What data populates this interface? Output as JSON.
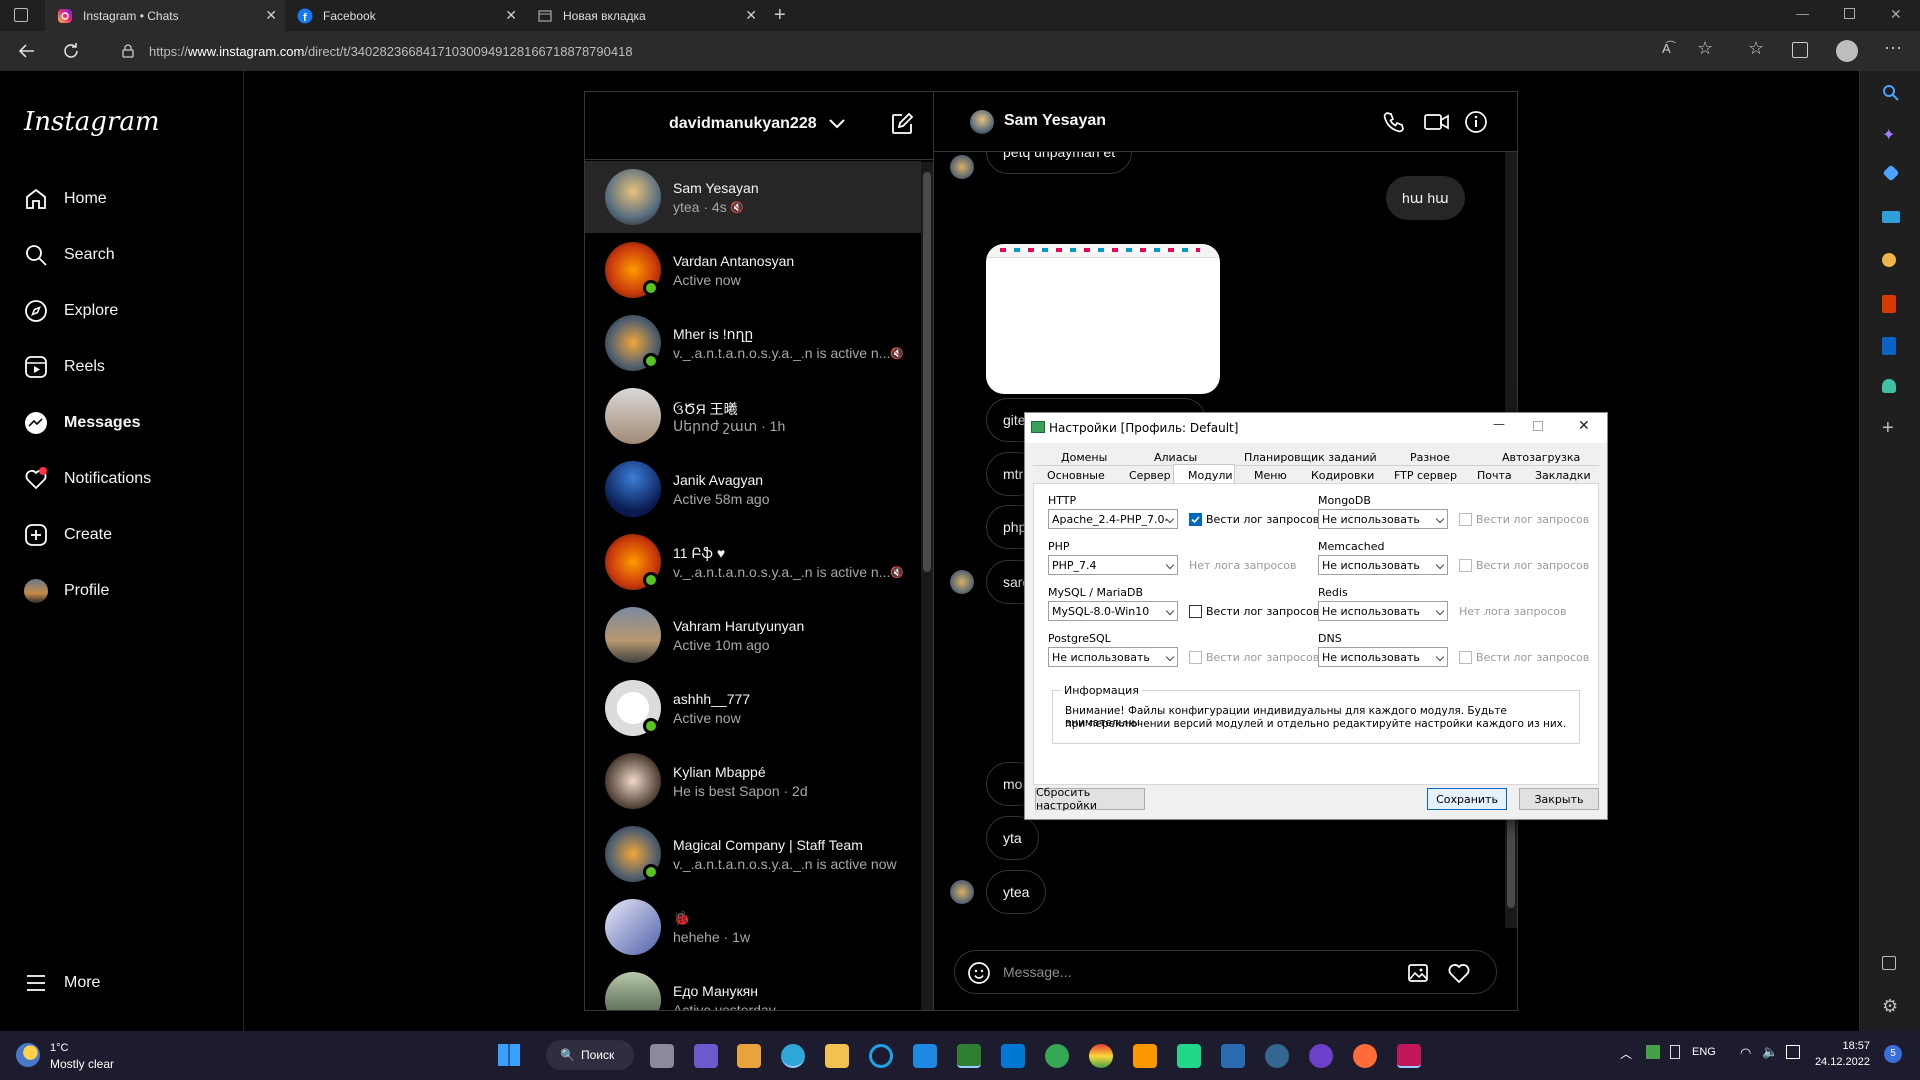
{
  "browser": {
    "tabs": [
      {
        "title": "Instagram • Chats"
      },
      {
        "title": "Facebook"
      },
      {
        "title": "Новая вкладка"
      }
    ],
    "url_prefix": "https://",
    "url_domain": "www.instagram.com",
    "url_path": "/direct/t/340282366841710300949128166718878790418"
  },
  "instagram": {
    "logo": "Instagram",
    "nav": [
      {
        "label": "Home",
        "icon": "home-icon"
      },
      {
        "label": "Search",
        "icon": "search-icon"
      },
      {
        "label": "Explore",
        "icon": "explore-icon"
      },
      {
        "label": "Reels",
        "icon": "reels-icon"
      },
      {
        "label": "Messages",
        "icon": "messenger-icon"
      },
      {
        "label": "Notifications",
        "icon": "heart-icon"
      },
      {
        "label": "Create",
        "icon": "plus-square-icon"
      },
      {
        "label": "Profile",
        "icon": "profile-avatar"
      },
      {
        "label": "More",
        "icon": "menu-icon"
      }
    ],
    "dm": {
      "username": "davidmanukyan228",
      "conversations": [
        {
          "name": "Sam Yesayan",
          "sub": "ytea · 4s",
          "online": false,
          "muted": true
        },
        {
          "name": "Vardan Antanosyan",
          "sub": "Active now",
          "online": true,
          "muted": false
        },
        {
          "name": "Mher is !ողը",
          "sub": "v._.a.n.t.a.n.o.s.y.a._.n is active n...",
          "online": true,
          "muted": true
        },
        {
          "name": "ઉԾЯ 王曦",
          "sub": "Սերոժ շատ · 1h",
          "online": false,
          "muted": false
        },
        {
          "name": "Janik Avagyan",
          "sub": "Active 58m ago",
          "online": false,
          "muted": false
        },
        {
          "name": "11 Բֆ ♥",
          "sub": "v._.a.n.t.a.n.o.s.y.a._.n is active n...",
          "online": true,
          "muted": true
        },
        {
          "name": "Vahram Harutyunyan",
          "sub": "Active 10m ago",
          "online": false,
          "muted": false
        },
        {
          "name": "ashhh__777",
          "sub": "Active now",
          "online": true,
          "muted": false
        },
        {
          "name": "Kylian Mbappé",
          "sub": "He is best Sapon · 2d",
          "online": false,
          "muted": false
        },
        {
          "name": "Magical Company | Staff Team",
          "sub": "v._.a.n.t.a.n.o.s.y.a._.n is active now",
          "online": true,
          "muted": false
        },
        {
          "name": "🐞",
          "sub": "hehehe · 1w",
          "online": false,
          "muted": false
        },
        {
          "name": "Едо Манукян",
          "sub": "Active yesterday",
          "online": false,
          "muted": false
        }
      ]
    },
    "chat": {
      "contact": "Sam Yesayan",
      "messages": {
        "m0": "petq unpayman et",
        "m1": "hա hա",
        "m2": "gite",
        "m3": "mtr",
        "m4": "php",
        "m5": "sarc",
        "m6": "mo",
        "m7": "yta",
        "m8": "ytea"
      },
      "composer_placeholder": "Message..."
    }
  },
  "dialog": {
    "title": "Настройки [Профиль: Default]",
    "tabs_row1": [
      "Домены",
      "Алиасы",
      "Планировщик заданий",
      "Разное",
      "Автозагрузка"
    ],
    "tabs_row2": [
      "Основные",
      "Сервер",
      "Модули",
      "Меню",
      "Кодировки",
      "FTP сервер",
      "Почта",
      "Закладки"
    ],
    "active_tab": "Модули",
    "modules": [
      {
        "label": "HTTP",
        "value": "Apache_2.4-PHP_7.0-",
        "log": "Вести лог запросов",
        "checked": true,
        "disabled": false
      },
      {
        "label": "PHP",
        "value": "PHP_7.4",
        "log": "Нет лога запросов",
        "checked": false,
        "disabled": true,
        "nobox": true
      },
      {
        "label": "MySQL / MariaDB",
        "value": "MySQL-8.0-Win10",
        "log": "Вести лог запросов",
        "checked": false,
        "disabled": false
      },
      {
        "label": "PostgreSQL",
        "value": "Не использовать",
        "log": "Вести лог запросов",
        "checked": false,
        "disabled": true
      },
      {
        "label": "MongoDB",
        "value": "Не использовать",
        "log": "Вести лог запросов",
        "checked": false,
        "disabled": true
      },
      {
        "label": "Memcached",
        "value": "Не использовать",
        "log": "Вести лог запросов",
        "checked": false,
        "disabled": true
      },
      {
        "label": "Redis",
        "value": "Не использовать",
        "log": "Нет лога запросов",
        "checked": false,
        "disabled": true,
        "nobox": true
      },
      {
        "label": "DNS",
        "value": "Не использовать",
        "log": "Вести лог запросов",
        "checked": false,
        "disabled": true
      }
    ],
    "info_title": "Информация",
    "info_line1": "Внимание! Файлы конфигурации индивидуальны для каждого модуля. Будьте внимательны",
    "info_line2": "при переключении версий модулей и отдельно редактируйте настройки каждого из них.",
    "reset_label": "Сбросить настройки",
    "save_label": "Сохранить",
    "close_label": "Закрыть"
  },
  "taskbar": {
    "temp": "1°C",
    "weather": "Mostly clear",
    "search_label": "Поиск",
    "lang": "ENG",
    "time": "18:57",
    "date": "24.12.2022",
    "notif_count": "5"
  }
}
